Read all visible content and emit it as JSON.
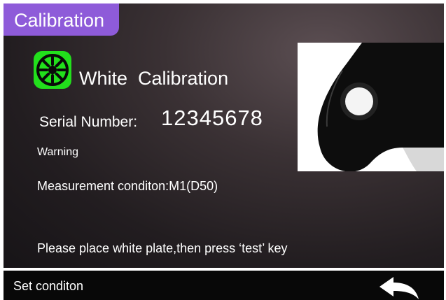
{
  "header": {
    "title": "Calibration"
  },
  "calibration": {
    "heading": "White  Calibration",
    "serial_label": "Serial Number:",
    "serial_value": "12345678",
    "warning": "Warning",
    "condition": "Measurement conditon:M1(D50)",
    "instruction": "Please place white plate,then press ‘test’ key"
  },
  "footer": {
    "set_condition": "Set conditon"
  },
  "colors": {
    "title_tab": "#8e5bd9",
    "icon_green": "#22e01c",
    "background_dark": "#2a2326",
    "footer_bar": "#080808"
  },
  "icons": {
    "calibration": "aperture-icon",
    "back": "back-arrow-icon"
  }
}
